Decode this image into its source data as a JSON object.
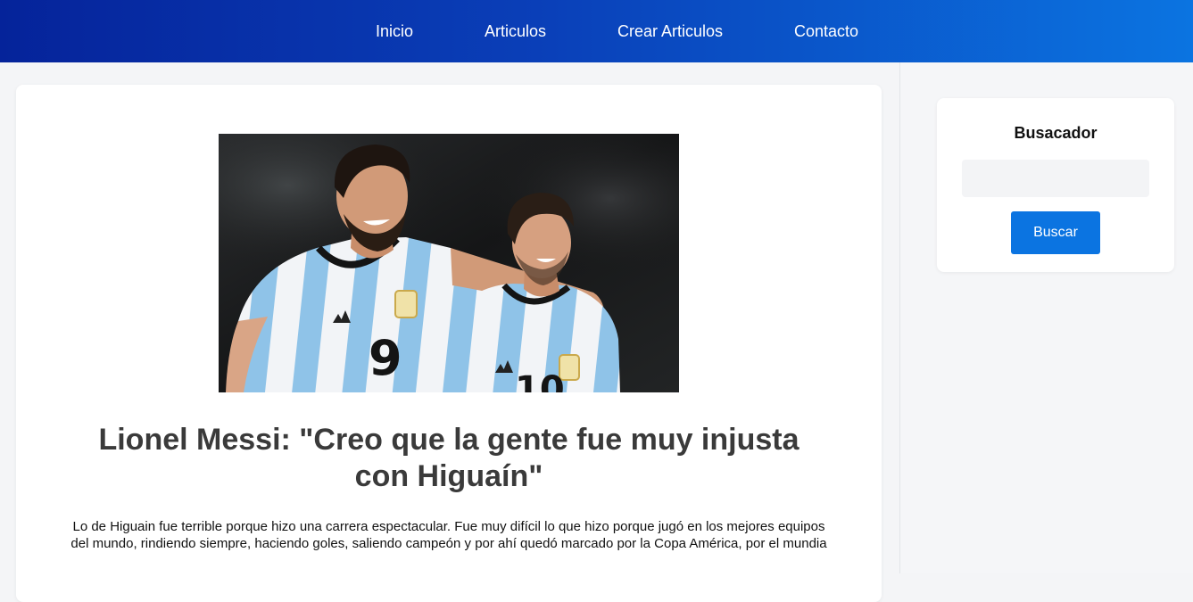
{
  "nav": {
    "items": [
      {
        "label": "Inicio"
      },
      {
        "label": "Articulos"
      },
      {
        "label": "Crear Articulos"
      },
      {
        "label": "Contacto"
      }
    ]
  },
  "article": {
    "image_icon": "football-players-photo",
    "title": "Lionel Messi: \"Creo que la gente fue muy injusta con Higuaín\"",
    "body": "Lo de Higuain fue terrible porque hizo una carrera espectacular. Fue muy difícil lo que hizo porque jugó en los mejores equipos del mundo, rindiendo siempre, haciendo goles, saliendo campeón y por ahí quedó marcado por la Copa América, por el mundia"
  },
  "sidebar": {
    "search": {
      "title": "Busacador",
      "input_value": "",
      "input_placeholder": "",
      "button_label": "Buscar"
    }
  },
  "colors": {
    "header_start": "#05239a",
    "header_end": "#0b74e1",
    "accent": "#0b74e1",
    "jersey_light_blue": "#8fc3e8"
  }
}
